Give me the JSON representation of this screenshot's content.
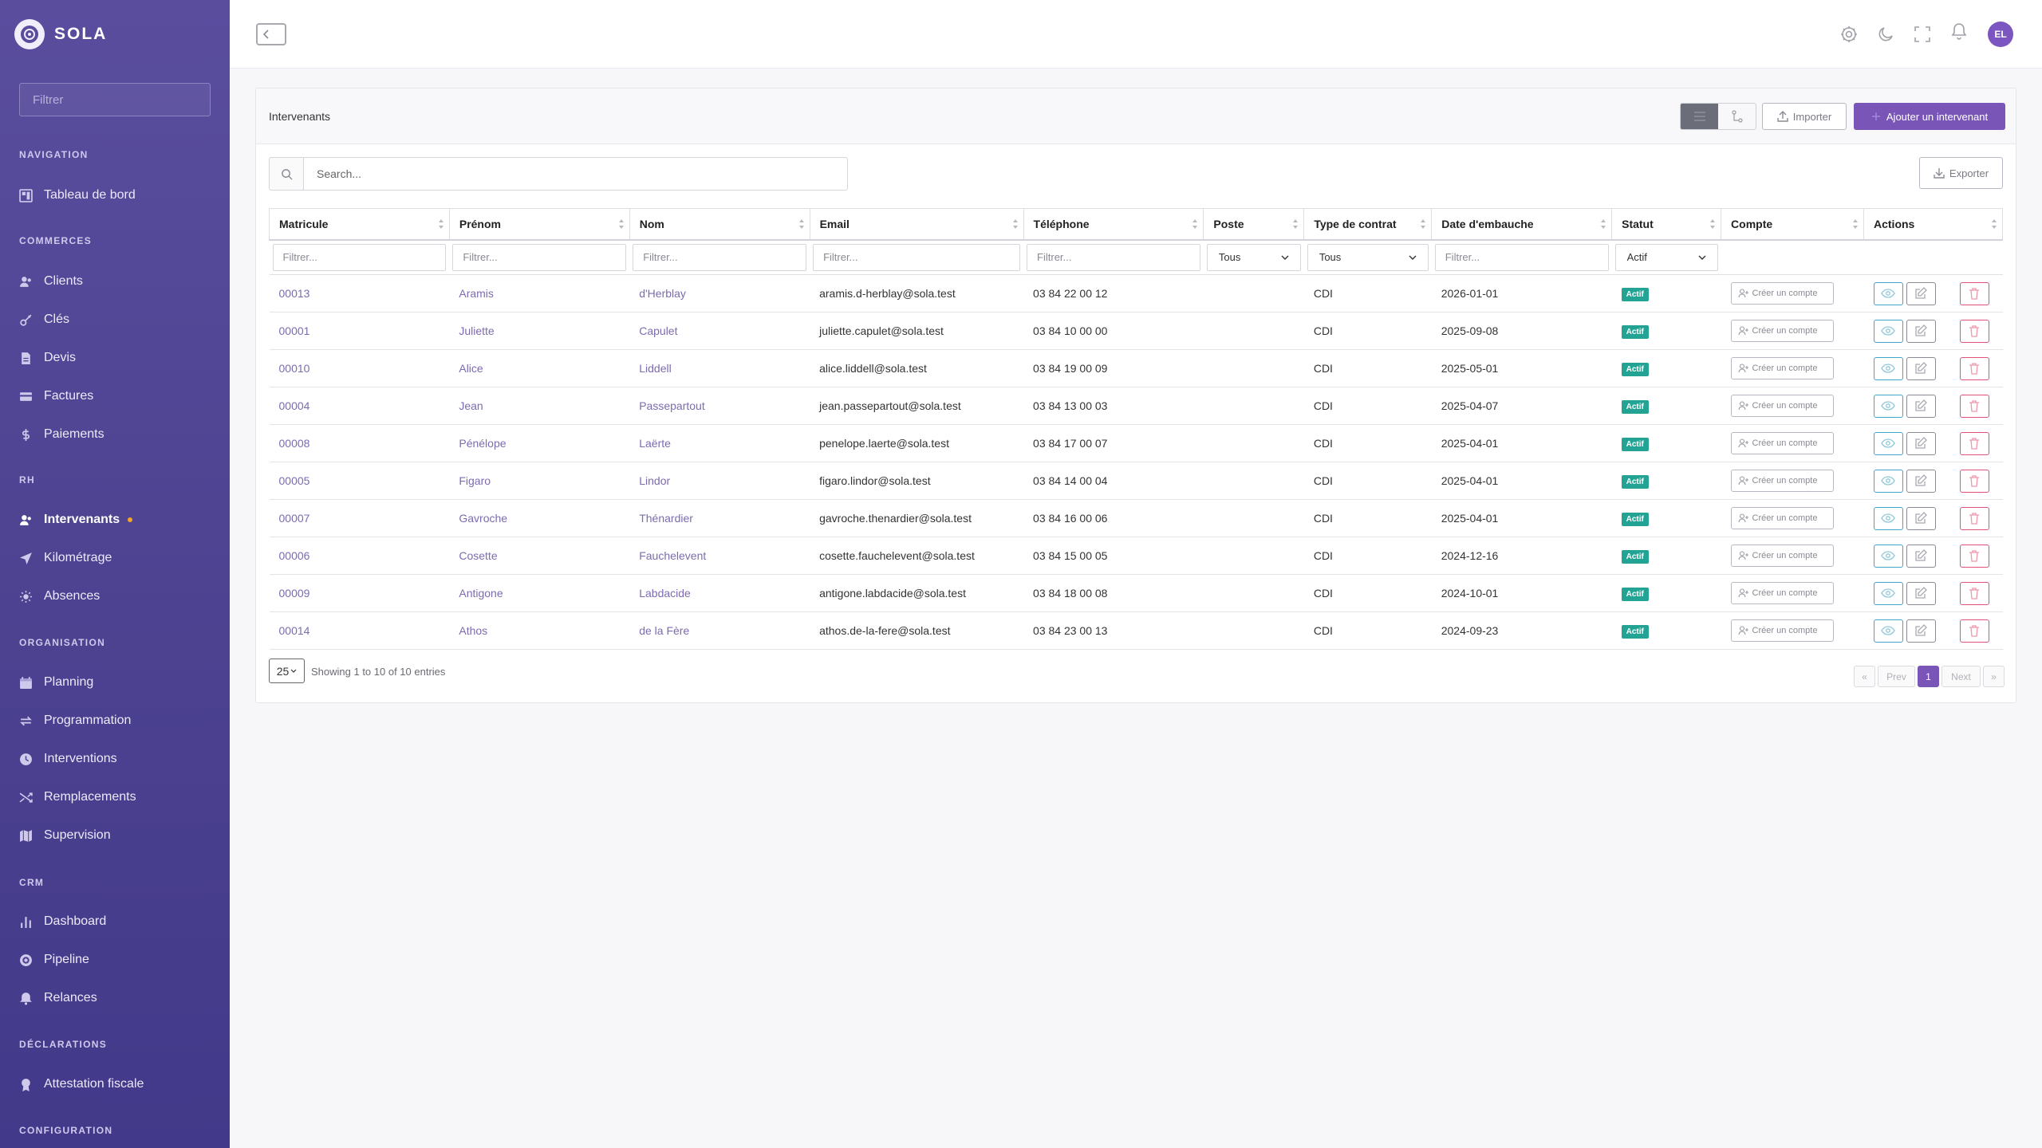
{
  "app": {
    "brand": "SOLA"
  },
  "sidebar": {
    "filter_placeholder": "Filtrer",
    "sections": [
      {
        "title": "NAVIGATION",
        "items": [
          {
            "label": "Tableau de bord",
            "icon": "dashboard-icon"
          }
        ]
      },
      {
        "title": "COMMERCES",
        "items": [
          {
            "label": "Clients",
            "icon": "users-icon"
          },
          {
            "label": "Clés",
            "icon": "key-icon"
          },
          {
            "label": "Devis",
            "icon": "document-icon"
          },
          {
            "label": "Factures",
            "icon": "card-icon"
          },
          {
            "label": "Paiements",
            "icon": "dollar-icon"
          }
        ]
      },
      {
        "title": "RH",
        "items": [
          {
            "label": "Intervenants",
            "icon": "users-icon",
            "active": true
          },
          {
            "label": "Kilométrage",
            "icon": "send-icon"
          },
          {
            "label": "Absences",
            "icon": "sun-icon"
          }
        ]
      },
      {
        "title": "ORGANISATION",
        "items": [
          {
            "label": "Planning",
            "icon": "calendar-icon"
          },
          {
            "label": "Programmation",
            "icon": "repeat-icon"
          },
          {
            "label": "Interventions",
            "icon": "clock-icon"
          },
          {
            "label": "Remplacements",
            "icon": "shuffle-icon"
          },
          {
            "label": "Supervision",
            "icon": "map-icon"
          }
        ]
      },
      {
        "title": "CRM",
        "items": [
          {
            "label": "Dashboard",
            "icon": "bar-chart-icon"
          },
          {
            "label": "Pipeline",
            "icon": "target-icon"
          },
          {
            "label": "Relances",
            "icon": "bell-icon"
          }
        ]
      },
      {
        "title": "DÉCLARATIONS",
        "items": [
          {
            "label": "Attestation fiscale",
            "icon": "award-icon"
          }
        ]
      },
      {
        "title": "CONFIGURATION",
        "items": []
      }
    ]
  },
  "topbar": {
    "avatar_initials": "EL",
    "icons": [
      "settings-icon",
      "moon-icon",
      "fullscreen-icon",
      "bell-icon"
    ]
  },
  "card": {
    "title": "Intervenants",
    "import_label": "Importer",
    "add_label": "Ajouter un intervenant",
    "export_label": "Exporter",
    "search_placeholder": "Search...",
    "columns": [
      "Matricule",
      "Prénom",
      "Nom",
      "Email",
      "Téléphone",
      "Poste",
      "Type de contrat",
      "Date d'embauche",
      "Statut",
      "Compte",
      "Actions"
    ],
    "filter_placeholder": "Filtrer...",
    "poste_filter": "Tous",
    "contrat_filter": "Tous",
    "statut_filter": "Actif",
    "account_button": "Créer un compte",
    "rows": [
      {
        "matricule": "00013",
        "prenom": "Aramis",
        "nom": "d'Herblay",
        "email": "aramis.d-herblay@sola.test",
        "telephone": "03 84 22 00 12",
        "poste": "",
        "contrat": "CDI",
        "embauche": "2026-01-01",
        "statut": "Actif"
      },
      {
        "matricule": "00001",
        "prenom": "Juliette",
        "nom": "Capulet",
        "email": "juliette.capulet@sola.test",
        "telephone": "03 84 10 00 00",
        "poste": "",
        "contrat": "CDI",
        "embauche": "2025-09-08",
        "statut": "Actif"
      },
      {
        "matricule": "00010",
        "prenom": "Alice",
        "nom": "Liddell",
        "email": "alice.liddell@sola.test",
        "telephone": "03 84 19 00 09",
        "poste": "",
        "contrat": "CDI",
        "embauche": "2025-05-01",
        "statut": "Actif"
      },
      {
        "matricule": "00004",
        "prenom": "Jean",
        "nom": "Passepartout",
        "email": "jean.passepartout@sola.test",
        "telephone": "03 84 13 00 03",
        "poste": "",
        "contrat": "CDI",
        "embauche": "2025-04-07",
        "statut": "Actif"
      },
      {
        "matricule": "00008",
        "prenom": "Pénélope",
        "nom": "Laërte",
        "email": "penelope.laerte@sola.test",
        "telephone": "03 84 17 00 07",
        "poste": "",
        "contrat": "CDI",
        "embauche": "2025-04-01",
        "statut": "Actif"
      },
      {
        "matricule": "00005",
        "prenom": "Figaro",
        "nom": "Lindor",
        "email": "figaro.lindor@sola.test",
        "telephone": "03 84 14 00 04",
        "poste": "",
        "contrat": "CDI",
        "embauche": "2025-04-01",
        "statut": "Actif"
      },
      {
        "matricule": "00007",
        "prenom": "Gavroche",
        "nom": "Thénardier",
        "email": "gavroche.thenardier@sola.test",
        "telephone": "03 84 16 00 06",
        "poste": "",
        "contrat": "CDI",
        "embauche": "2025-04-01",
        "statut": "Actif"
      },
      {
        "matricule": "00006",
        "prenom": "Cosette",
        "nom": "Fauchelevent",
        "email": "cosette.fauchelevent@sola.test",
        "telephone": "03 84 15 00 05",
        "poste": "",
        "contrat": "CDI",
        "embauche": "2024-12-16",
        "statut": "Actif"
      },
      {
        "matricule": "00009",
        "prenom": "Antigone",
        "nom": "Labdacide",
        "email": "antigone.labdacide@sola.test",
        "telephone": "03 84 18 00 08",
        "poste": "",
        "contrat": "CDI",
        "embauche": "2024-10-01",
        "statut": "Actif"
      },
      {
        "matricule": "00014",
        "prenom": "Athos",
        "nom": "de la Fère",
        "email": "athos.de-la-fere@sola.test",
        "telephone": "03 84 23 00 13",
        "poste": "",
        "contrat": "CDI",
        "embauche": "2024-09-23",
        "statut": "Actif"
      }
    ],
    "page_length": "25",
    "info": "Showing 1 to 10 of 10 entries",
    "pagination": {
      "first": "«",
      "prev": "Prev",
      "current": "1",
      "next": "Next",
      "last": "»"
    }
  },
  "colors": {
    "sidebar": "#4e4492",
    "accent": "#7a55b8",
    "badge": "#23a394",
    "link": "#7d6bb0",
    "delete": "#e0527a",
    "view": "#3fa6c7"
  }
}
